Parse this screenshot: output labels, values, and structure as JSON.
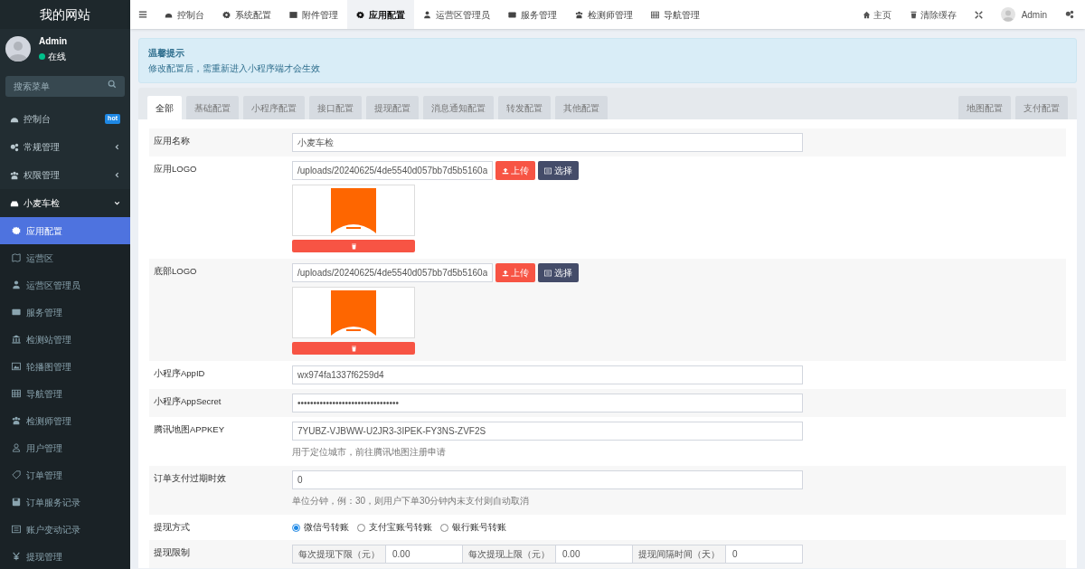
{
  "sidebar": {
    "site_title": "我的网站",
    "user": {
      "name": "Admin",
      "status": "在线"
    },
    "search": {
      "placeholder": "搜索菜单"
    },
    "items": [
      {
        "label": "控制台",
        "badge": "hot",
        "selected": false
      },
      {
        "label": "常规管理",
        "expanded": false,
        "selected": false
      },
      {
        "label": "权限管理",
        "expanded": false,
        "selected": false
      },
      {
        "label": "小麦车检",
        "expanded": true,
        "selected": false,
        "children": [
          {
            "label": "应用配置",
            "selected": true
          },
          {
            "label": "运营区",
            "selected": false
          },
          {
            "label": "运营区管理员",
            "selected": false
          },
          {
            "label": "服务管理",
            "selected": false
          },
          {
            "label": "检测站管理",
            "selected": false
          },
          {
            "label": "轮播图管理",
            "selected": false
          },
          {
            "label": "导航管理",
            "selected": false
          },
          {
            "label": "检测师管理",
            "selected": false
          },
          {
            "label": "用户管理",
            "selected": false
          },
          {
            "label": "订单管理",
            "selected": false
          },
          {
            "label": "订单服务记录",
            "selected": false
          },
          {
            "label": "账户变动记录",
            "selected": false
          },
          {
            "label": "提现管理",
            "selected": false
          }
        ]
      }
    ]
  },
  "top_tabs": [
    {
      "label": "控制台",
      "selected": false
    },
    {
      "label": "系统配置",
      "selected": false
    },
    {
      "label": "附件管理",
      "selected": false
    },
    {
      "label": "应用配置",
      "selected": true
    },
    {
      "label": "运营区管理员",
      "selected": false
    },
    {
      "label": "服务管理",
      "selected": false
    },
    {
      "label": "检测师管理",
      "selected": false
    },
    {
      "label": "导航管理",
      "selected": false
    }
  ],
  "top_right": {
    "home": "主页",
    "clear_cache": "清除缓存",
    "user": "Admin"
  },
  "notice": {
    "title": "温馨提示",
    "text": "修改配置后，需重新进入小程序端才会生效"
  },
  "config_tabs": [
    {
      "label": "全部",
      "selected": true
    },
    {
      "label": "基础配置",
      "selected": false
    },
    {
      "label": "小程序配置",
      "selected": false
    },
    {
      "label": "接口配置",
      "selected": false
    },
    {
      "label": "提现配置",
      "selected": false
    },
    {
      "label": "消息通知配置",
      "selected": false
    },
    {
      "label": "转发配置",
      "selected": false
    },
    {
      "label": "其他配置",
      "selected": false
    }
  ],
  "config_tabs_right": [
    {
      "label": "地图配置",
      "selected": false
    },
    {
      "label": "支付配置",
      "selected": false
    }
  ],
  "form": [
    {
      "kind": "text",
      "label": "应用名称",
      "value": "小麦车检"
    },
    {
      "kind": "upload",
      "label": "应用LOGO",
      "value": "/uploads/20240625/4de5540d057bb7d5b5160a",
      "upload": "上传",
      "choose": "选择"
    },
    {
      "kind": "upload",
      "label": "底部LOGO",
      "value": "/uploads/20240625/4de5540d057bb7d5b5160a",
      "upload": "上传",
      "choose": "选择"
    },
    {
      "kind": "text",
      "label": "小程序AppID",
      "value": "wx974fa1337f6259d4"
    },
    {
      "kind": "text",
      "label": "小程序AppSecret",
      "value": "••••••••••••••••••••••••••••••••"
    },
    {
      "kind": "text",
      "label": "腾讯地图APPKEY",
      "value": "7YUBZ-VJBWW-U2JR3-3IPEK-FY3NS-ZVF2S",
      "help": "用于定位城市，前往腾讯地图注册申请"
    },
    {
      "kind": "text",
      "label": "订单支付过期时效",
      "value": "0",
      "help": "单位分钟，例：30，则用户下单30分钟内未支付则自动取消"
    },
    {
      "kind": "radio",
      "label": "提现方式",
      "options": [
        {
          "label": "微信号转账",
          "selected": true
        },
        {
          "label": "支付宝账号转账",
          "selected": false
        },
        {
          "label": "银行账号转账",
          "selected": false
        }
      ]
    },
    {
      "kind": "limits",
      "label": "提现限制",
      "pairs": [
        {
          "label": "每次提现下限（元）",
          "value": "0.00"
        },
        {
          "label": "每次提现上限（元）",
          "value": "0.00"
        },
        {
          "label": "提现间隔时间（天）",
          "value": "0"
        }
      ]
    }
  ]
}
